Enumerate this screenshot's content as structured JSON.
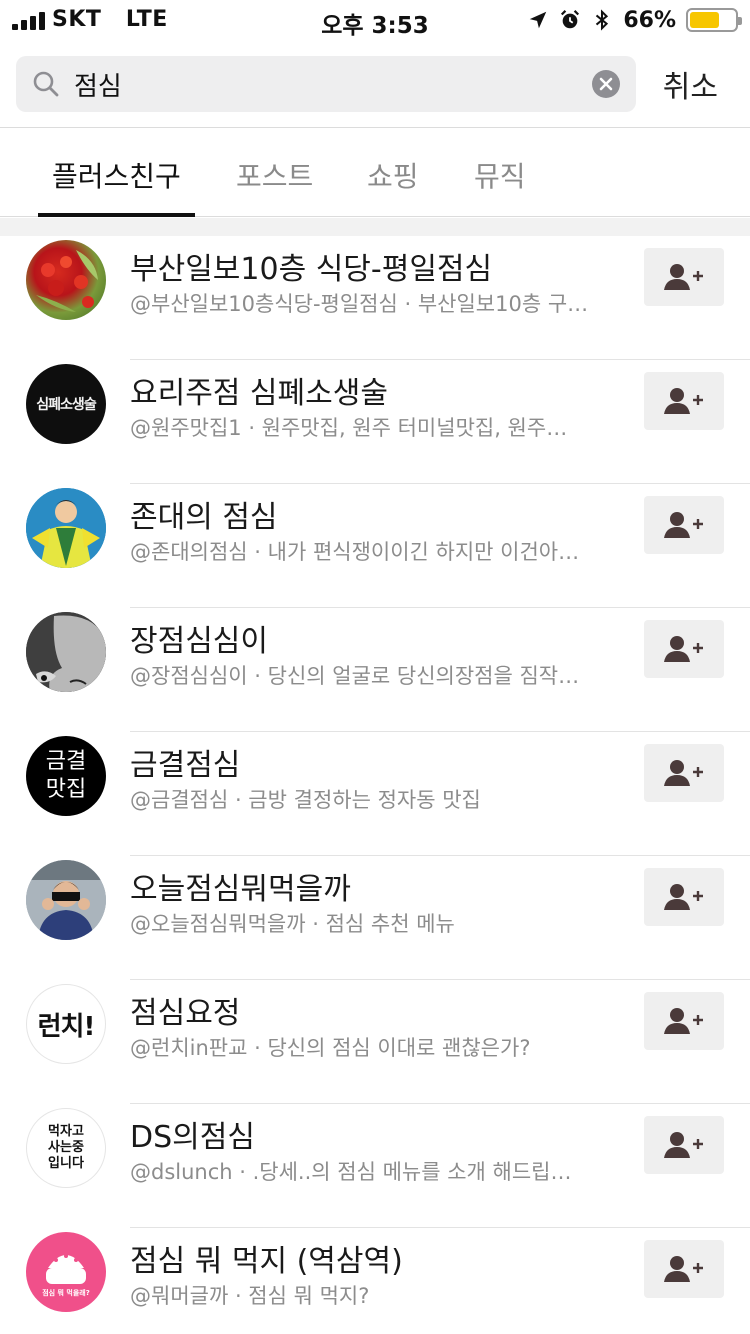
{
  "status_bar": {
    "carrier": "SKT   LTE",
    "time": "오후 3:53",
    "battery_percent": "66%",
    "battery_level": 0.66,
    "battery_color": "#f7c600",
    "icons": [
      "location-arrow-icon",
      "alarm-clock-icon",
      "bluetooth-icon"
    ]
  },
  "search": {
    "query": "점심",
    "cancel_label": "취소"
  },
  "tabs": [
    {
      "label": "플러스친구",
      "active": true
    },
    {
      "label": "포스트",
      "active": false
    },
    {
      "label": "쇼핑",
      "active": false
    },
    {
      "label": "뮤직",
      "active": false
    }
  ],
  "results": [
    {
      "name": "부산일보10층 식당-평일점심",
      "desc": "@부산일보10층식당-평일점심 · 부산일보10층 구…"
    },
    {
      "name": "요리주점 심폐소생술",
      "desc": "@원주맛집1 · 원주맛집, 원주 터미널맛집, 원주…",
      "avatar_text": "심폐소생술"
    },
    {
      "name": "존대의 점심",
      "desc": "@존대의점심 · 내가 편식쟁이이긴 하지만 이건아…"
    },
    {
      "name": "장점심심이",
      "desc": "@장점심심이 · 당신의 얼굴로 당신의장점을 짐작…"
    },
    {
      "name": "금결점심",
      "desc": "@금결점심 · 금방 결정하는 정자동 맛집",
      "avatar_text": [
        "금결",
        "맛집"
      ]
    },
    {
      "name": "오늘점심뭐먹을까",
      "desc": "@오늘점심뭐먹을까 · 점심 추천 메뉴"
    },
    {
      "name": "점심요정",
      "desc": "@런치in판교 · 당신의 점심 이대로 괜찮은가?",
      "avatar_text": "런치!"
    },
    {
      "name": "DS의점심",
      "desc": "@dslunch · .당세..의 점심 메뉴를 소개 해드립…",
      "avatar_text": [
        "먹자고",
        "사는중",
        "입니다"
      ]
    },
    {
      "name": "점심 뭐 먹지 (역삼역)",
      "desc": "@뭐머글까 · 점심 뭐 먹지?",
      "avatar_text": "점심 뭐 먹을래?"
    }
  ],
  "add_friend_icon": "add-friend-icon"
}
